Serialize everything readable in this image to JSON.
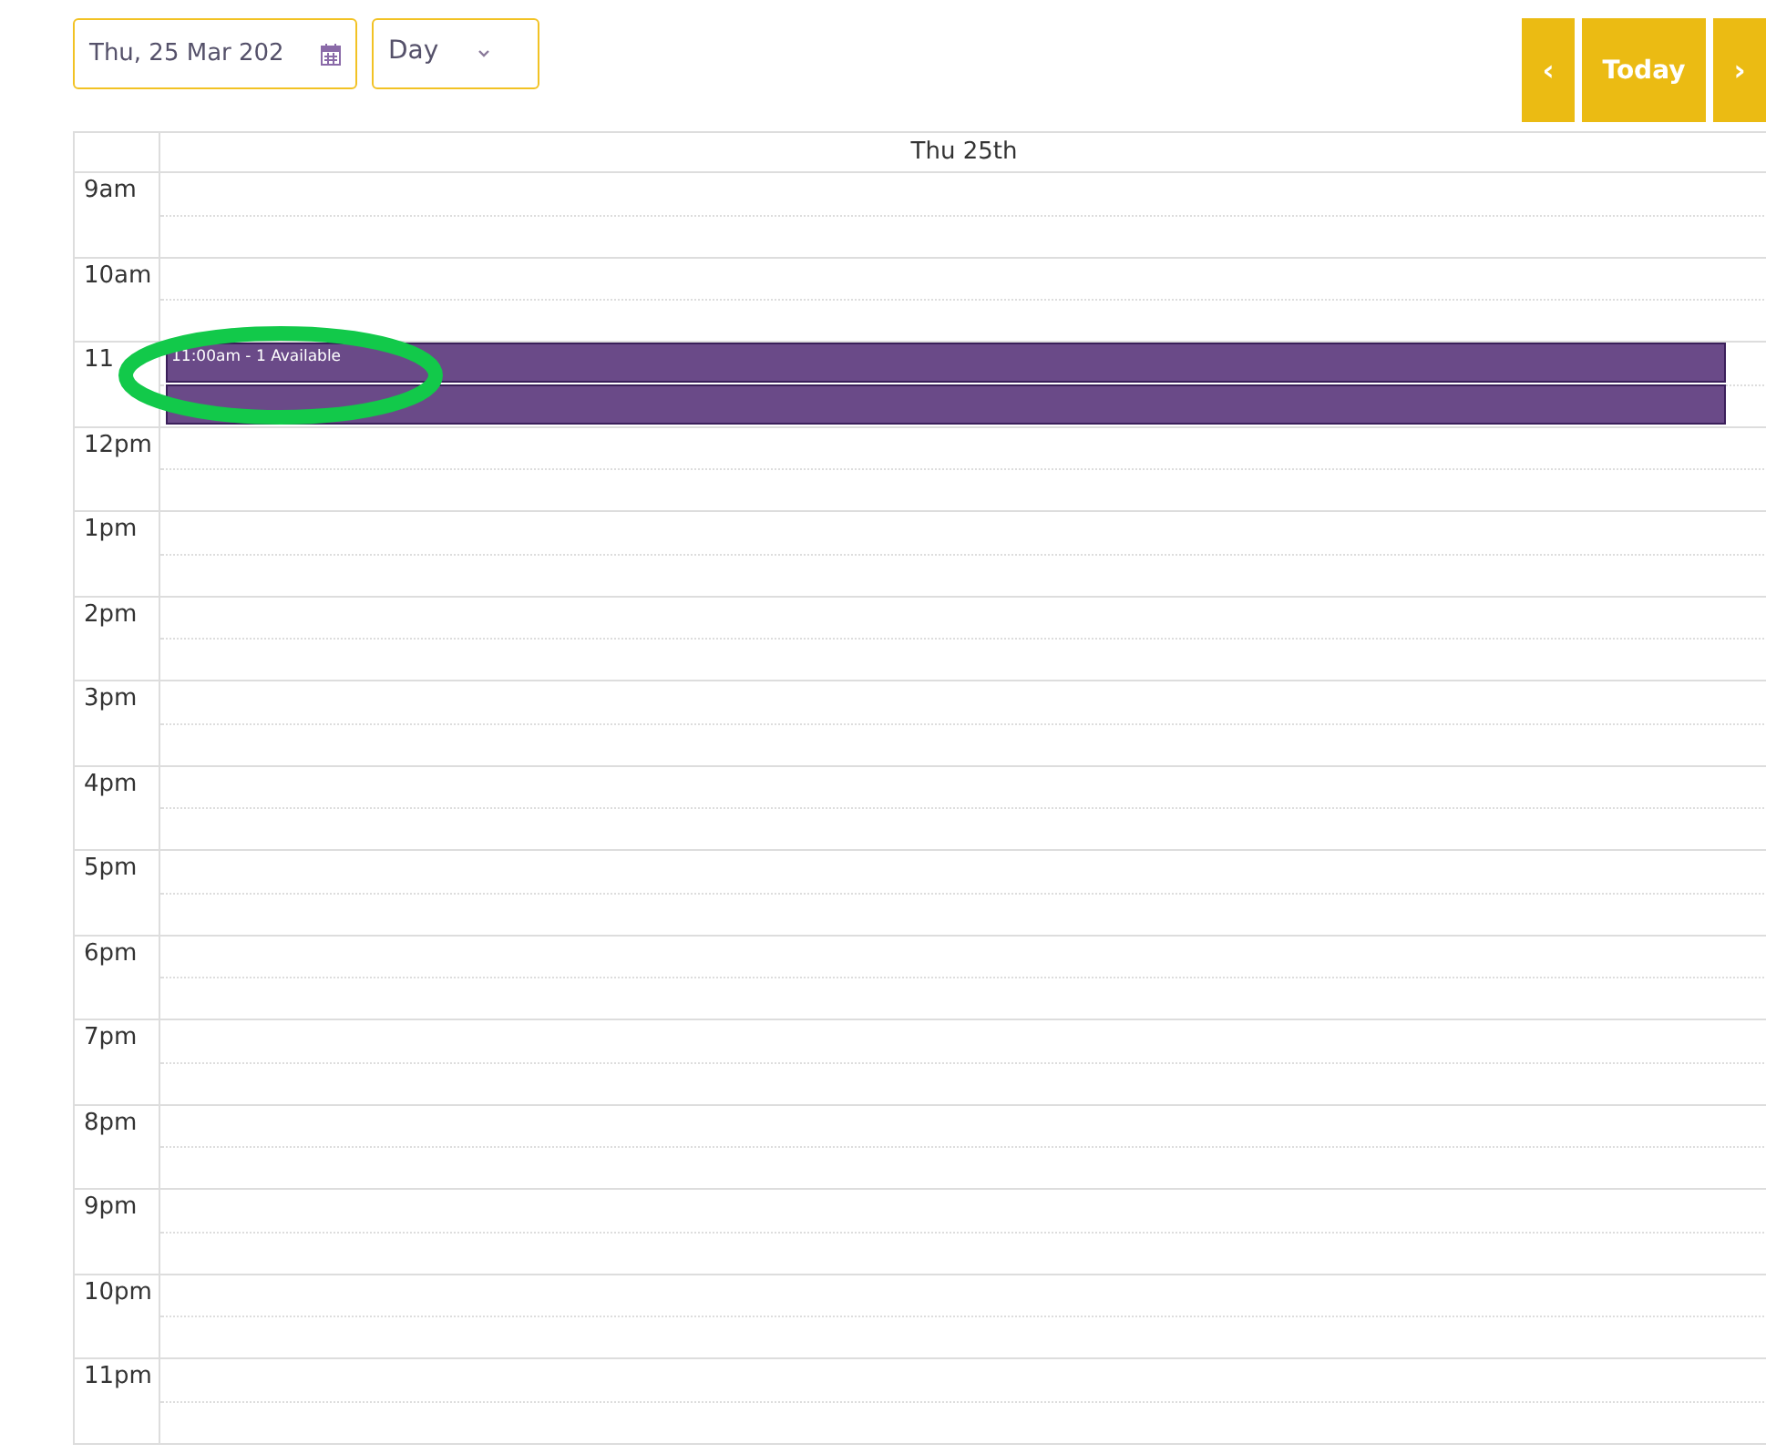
{
  "toolbar": {
    "date_field": {
      "value": "Thu, 25 Mar 202"
    },
    "view_select": {
      "value": "Day"
    },
    "nav": [
      {
        "kind": "prev",
        "label": "‹"
      },
      {
        "kind": "today",
        "label": "Today"
      },
      {
        "kind": "next",
        "label": "›"
      }
    ]
  },
  "calendar": {
    "day_header": "Thu 25th",
    "hours": [
      "9am",
      "10am",
      "11",
      "12pm",
      "1pm",
      "2pm",
      "3pm",
      "4pm",
      "5pm",
      "6pm",
      "7pm",
      "8pm",
      "9pm",
      "10pm",
      "11pm"
    ],
    "events": [
      {
        "title": "11:00am - 1 Available",
        "color": "#6a4a88"
      },
      {
        "color": "#6a4a88"
      }
    ]
  },
  "highlight": {
    "kind": "ellipse",
    "color": "#12c94a"
  }
}
